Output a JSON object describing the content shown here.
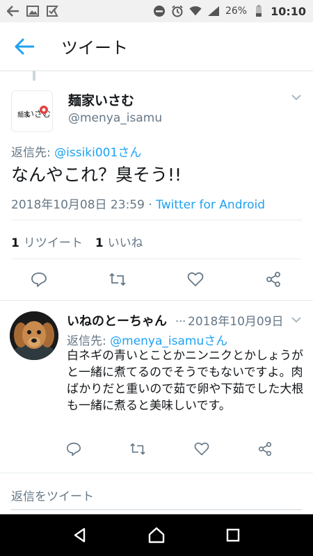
{
  "status_bar": {
    "battery": "26%",
    "time": "10:10"
  },
  "app_bar": {
    "title": "ツイート"
  },
  "main_tweet": {
    "name": "麺家いさむ",
    "handle": "@menya_isamu",
    "reply_prefix": "返信先: ",
    "reply_to": "@issiki001さん",
    "text": "なんやこれ？臭そう!!",
    "timestamp": "2018年10月08日 23:59 · ",
    "source": "Twitter for Android",
    "retweet_count": "1",
    "retweet_label": "リツイート",
    "like_count": "1",
    "like_label": "いいね",
    "logo_text": "麺家いさむ"
  },
  "reply_tweet": {
    "name": "いねのとーちゃん",
    "dots": "...",
    "date": "2018年10月09日",
    "reply_prefix": "返信先: ",
    "reply_to": "@menya_isamuさん",
    "text": "白ネギの青いとことかニンニクとかしょうがと一緒に煮てるのでそうでもないですよ。肉ばかりだと重いので茹で卵や下茹でした大根も一緒に煮ると美味しいです。"
  },
  "compose": {
    "placeholder": "返信をツイート"
  },
  "colors": {
    "accent": "#1da1f2",
    "secondary_text": "#657786",
    "divider": "#e6ecf0"
  }
}
